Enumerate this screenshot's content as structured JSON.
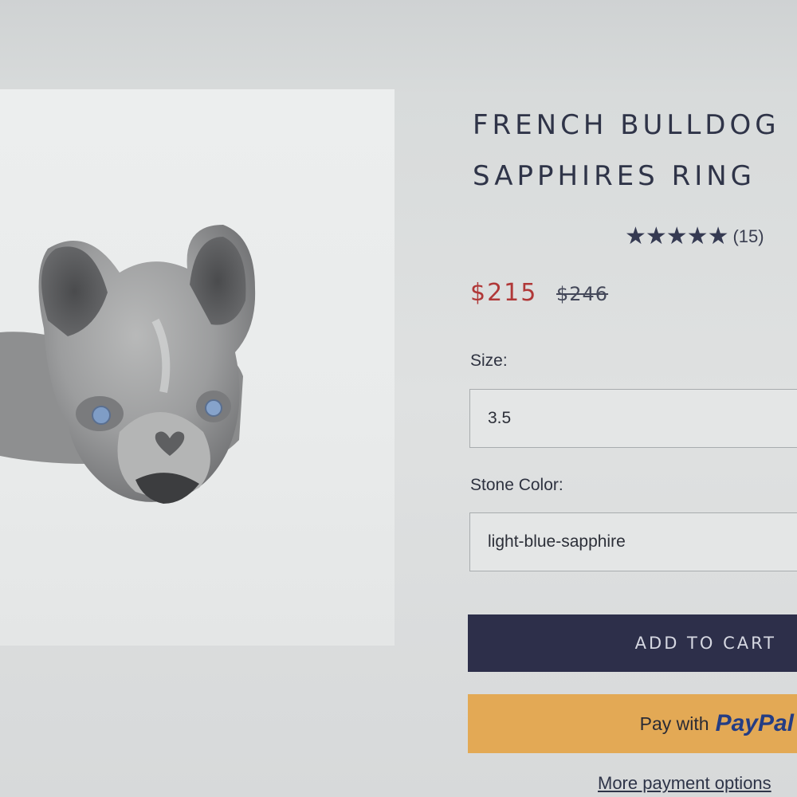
{
  "product": {
    "title_line1": "FRENCH BULLDOG",
    "title_line2": "SAPPHIRES RING",
    "rating_stars": "★★★★★",
    "rating_value": 5,
    "review_count": "(15)",
    "price": "$215",
    "compare_price": "$246"
  },
  "options": {
    "size_label": "Size:",
    "size_value": "3.5",
    "stone_label": "Stone Color:",
    "stone_value": "light-blue-sapphire"
  },
  "actions": {
    "add_to_cart": "ADD TO CART",
    "paypal_prefix": "Pay with",
    "paypal_brand": "PayPal",
    "more_payment": "More payment options"
  },
  "colors": {
    "price": "#b03838",
    "add_to_cart_bg": "#2d2f4a",
    "paypal_bg": "#e3a955",
    "paypal_brand": "#243d84"
  }
}
